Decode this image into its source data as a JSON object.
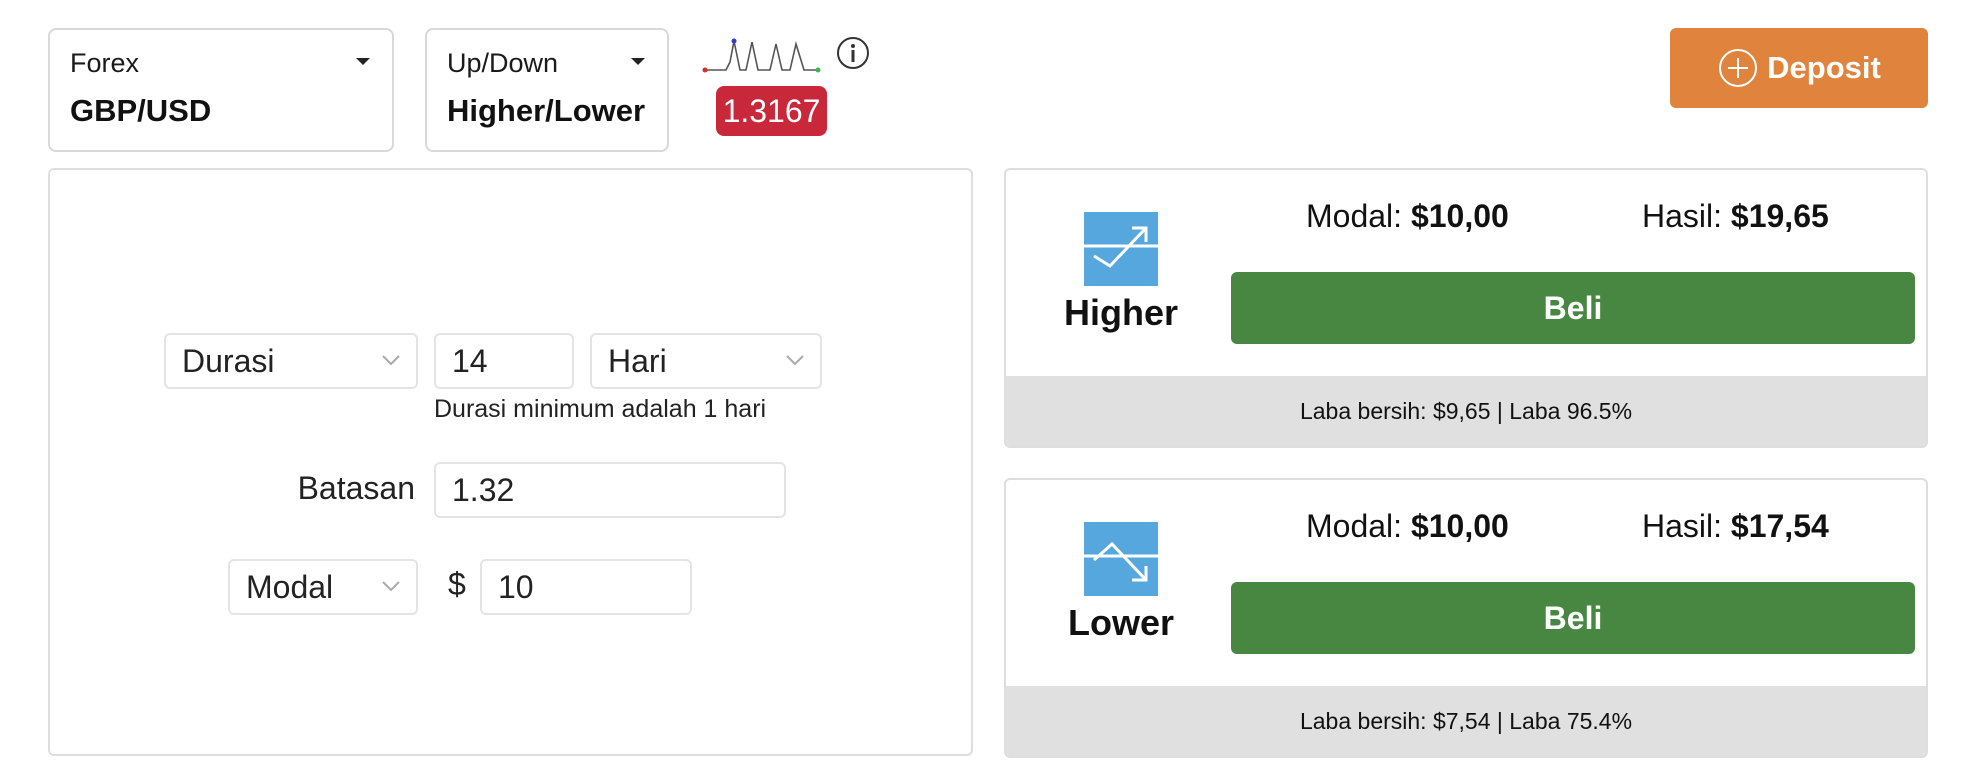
{
  "market_selector": {
    "category": "Forex",
    "value": "GBP/USD"
  },
  "type_selector": {
    "category": "Up/Down",
    "value": "Higher/Lower"
  },
  "price": {
    "current": "1.3167",
    "badge_color": "#c8283a"
  },
  "deposit": {
    "label": "Deposit",
    "color": "#e0843d"
  },
  "form": {
    "duration_select": "Durasi",
    "duration_value": "14",
    "duration_unit": "Hari",
    "duration_hint": "Durasi minimum adalah 1 hari",
    "limit_label": "Batasan",
    "limit_value": "1.32",
    "amount_select": "Modal",
    "currency_symbol": "$",
    "amount_value": "10"
  },
  "options": [
    {
      "name": "Higher",
      "icon": "trend-up-icon",
      "modal_label": "Modal:",
      "modal_value": "$10,00",
      "hasil_label": "Hasil:",
      "hasil_value": "$19,65",
      "buy_label": "Beli",
      "footer": "Laba bersih: $9,65 | Laba 96.5%"
    },
    {
      "name": "Lower",
      "icon": "trend-down-icon",
      "modal_label": "Modal:",
      "modal_value": "$10,00",
      "hasil_label": "Hasil:",
      "hasil_value": "$17,54",
      "buy_label": "Beli",
      "footer": "Laba bersih: $7,54 | Laba 75.4%"
    }
  ],
  "colors": {
    "buy_button": "#478741",
    "option_icon": "#55a7de",
    "footer_bg": "#e0e0e0"
  }
}
